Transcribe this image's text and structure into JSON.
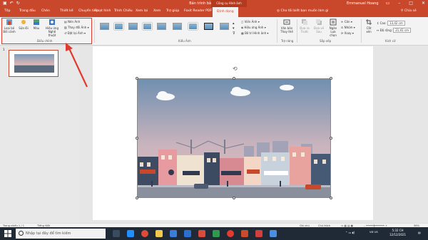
{
  "titlebar": {
    "title": "Bản trình bày1 - PowerPoint",
    "context_tab_title": "Công cụ Hình ảnh",
    "user": "Emmanuel Hoang"
  },
  "tabs": [
    "Tệp",
    "Trang đầu",
    "Chèn",
    "Thiết kế",
    "Chuyển tiếp",
    "Hoạt hình",
    "Trình Chiếu",
    "Xem lại",
    "Xem",
    "Trợ giúp",
    "Foxit Reader PDF",
    "Định dạng"
  ],
  "tell_me": "Cho tôi biết bạn muốn làm gì",
  "share": "Chia sẻ",
  "ribbon": {
    "adjust": {
      "remove_bg": "Loại bỏ Bối cảnh",
      "corrections": "Sửa lỗi",
      "color": "Màu",
      "artistic": "Hiệu ứng Nghệ thuật",
      "compress": "Nén Ảnh",
      "change": "Thay đổi Ảnh",
      "reset": "Đặt lại Ảnh",
      "label": "Điều chỉnh"
    },
    "styles_label": "Kiểu Ảnh",
    "picture_border": "Viền Ảnh",
    "picture_effects": "Hiệu ứng Ảnh",
    "picture_layout": "Bố trí Hình ảnh",
    "alt_text": "Văn bản Thay thế",
    "accessibility_label": "Trợ năng",
    "bring_forward": "Đưa ra Trước",
    "send_backward": "Đưa về Sau",
    "selection_pane": "Ngăn Lựa chọn",
    "align": "Căn",
    "group": "Nhóm",
    "rotate": "Xoay",
    "arrange_label": "Sắp xếp",
    "crop": "Cắt xén",
    "height_label": "Cao:",
    "height_value": "13,42 cm",
    "width_label": "Độ rộng:",
    "width_value": "21,41 cm",
    "size_label": "Kích cỡ"
  },
  "slide_number": "1",
  "status": {
    "slide_of": "Trang chiếu 1 / 1",
    "language": "Tiếng Việt",
    "notes": "Ghi chú",
    "comments": "Chú thích",
    "zoom": "56%"
  },
  "taskbar": {
    "search_placeholder": "Nhập tại đây để tìm kiếm",
    "language": "VIE US",
    "time": "5:32 CH",
    "date": "12/12/2021"
  },
  "colors": {
    "accent": "#c9472b",
    "callout": "#e03b2f"
  }
}
